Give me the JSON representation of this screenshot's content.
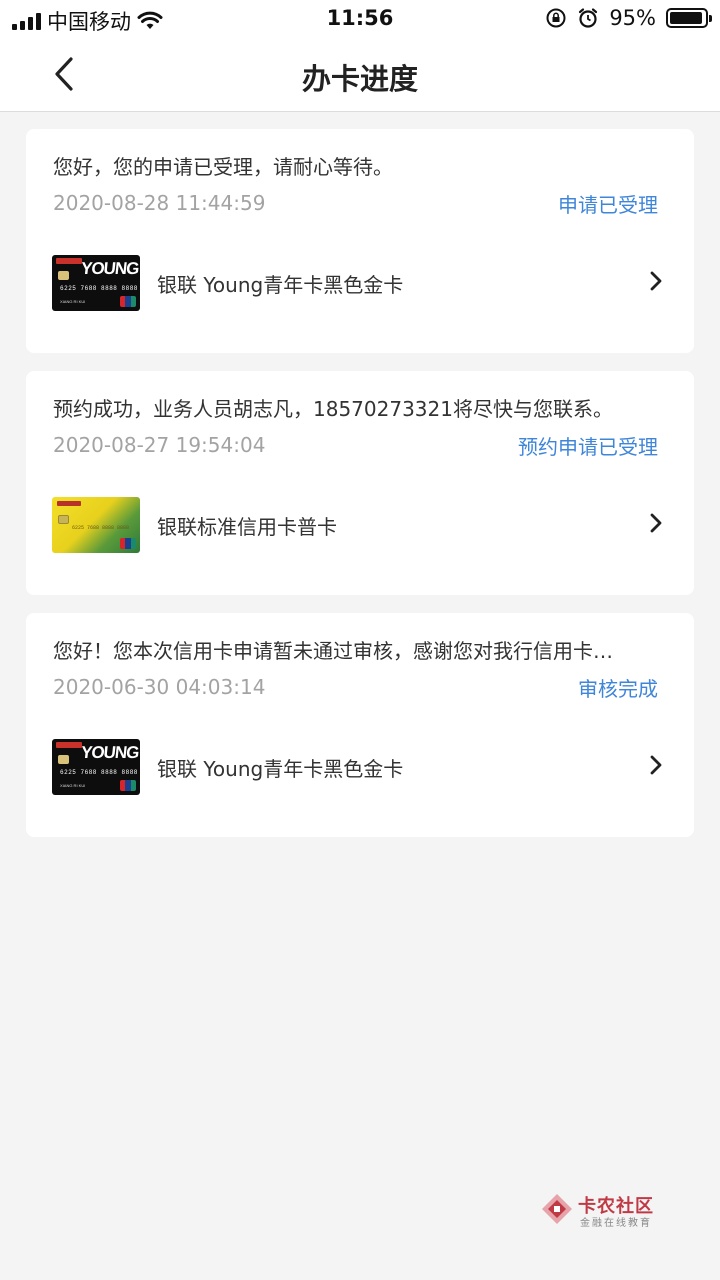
{
  "status_bar": {
    "carrier": "中国移动",
    "time": "11:56",
    "battery": "95%",
    "battery_level": 0.95
  },
  "header": {
    "title": "办卡进度",
    "back_icon": "chevron-left-icon"
  },
  "applications": [
    {
      "message": "您好，您的申请已受理，请耐心等待。",
      "time": "2020-08-28 11:44:59",
      "status": "申请已受理",
      "card_name": "银联 Young青年卡黑色金卡",
      "card_style": "young-black",
      "card_art": {
        "brand": "YOUNG",
        "number": "6225 7688 8888 8888",
        "holder": "XIANG RI KUI"
      }
    },
    {
      "message": "预约成功，业务人员胡志凡，18570273321将尽快与您联系。",
      "time": "2020-08-27 19:54:04",
      "status": "预约申请已受理",
      "card_name": "银联标准信用卡普卡",
      "card_style": "gold-sunflower",
      "card_art": {
        "number": "6225 7688 8888 8888"
      }
    },
    {
      "message": "您好！您本次信用卡申请暂未通过审核，感谢您对我行信用卡…",
      "time": "2020-06-30 04:03:14",
      "status": "审核完成",
      "card_name": "银联 Young青年卡黑色金卡",
      "card_style": "young-black",
      "card_art": {
        "brand": "YOUNG",
        "number": "6225 7688 8888 8888",
        "holder": "XIANG RI KUI"
      }
    }
  ],
  "watermark": {
    "title": "卡农社区",
    "subtitle": "金融在线教育"
  },
  "colors": {
    "accent": "#3f86d9",
    "background": "#f4f4f5",
    "muted_text": "#a3a3a3",
    "watermark": "#c03a46"
  }
}
